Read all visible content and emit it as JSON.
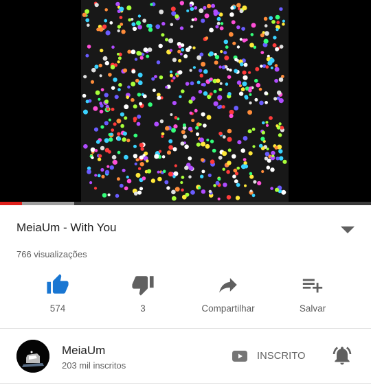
{
  "video": {
    "progress": {
      "played_fraction": 0.06,
      "buffered_fraction": 0.2
    },
    "title": "MeiaUm - With You",
    "views": "766 visualizações"
  },
  "actions": {
    "like": {
      "label": "574",
      "icon": "thumbs-up-icon"
    },
    "dislike": {
      "label": "3",
      "icon": "thumbs-down-icon"
    },
    "share": {
      "label": "Compartilhar",
      "icon": "share-icon"
    },
    "save": {
      "label": "Salvar",
      "icon": "playlist-add-icon"
    }
  },
  "channel": {
    "name": "MeiaUm",
    "subscribers": "203 mil inscritos",
    "subscribe_label": "INSCRITO"
  },
  "colors": {
    "accent_blue": "#1976d2",
    "progress_red": "#e0201b",
    "icon_gray": "#606060"
  }
}
